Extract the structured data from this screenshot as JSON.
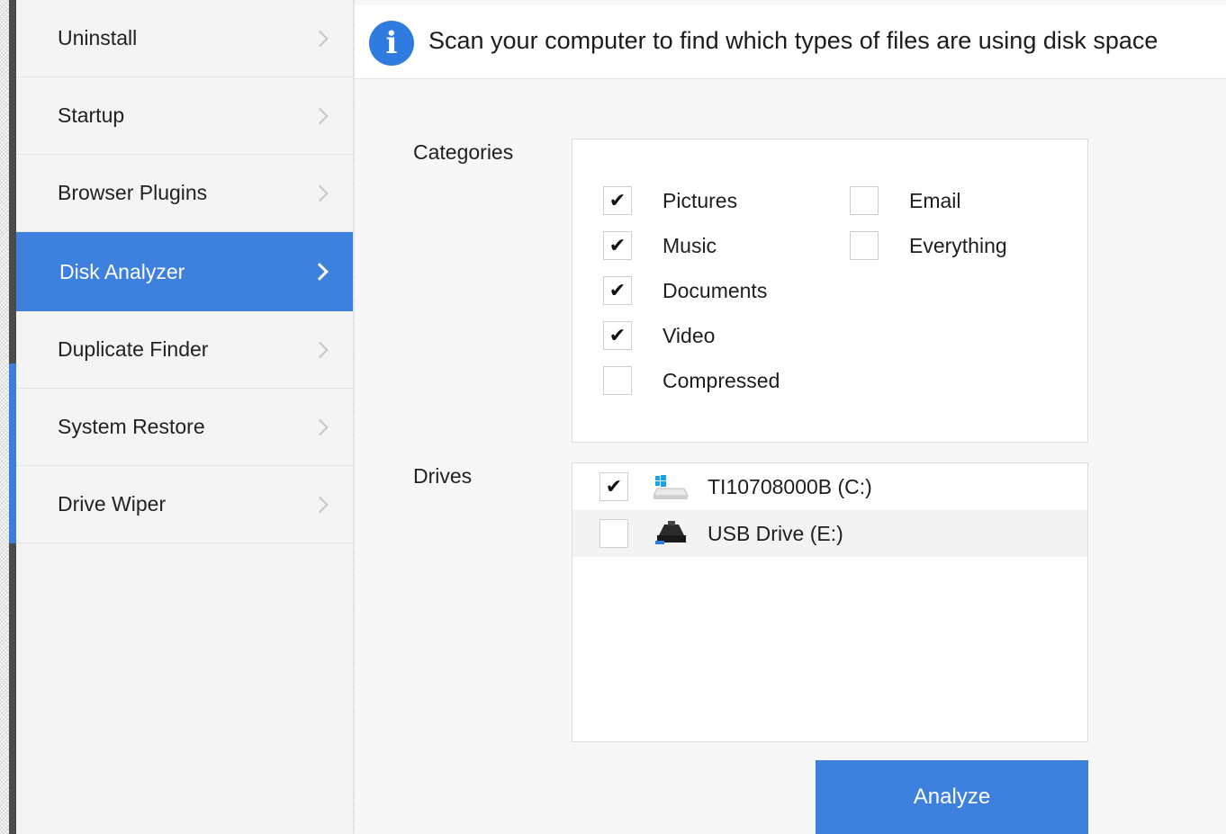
{
  "sidebar": {
    "items": [
      {
        "label": "Uninstall",
        "active": false
      },
      {
        "label": "Startup",
        "active": false
      },
      {
        "label": "Browser Plugins",
        "active": false
      },
      {
        "label": "Disk Analyzer",
        "active": true
      },
      {
        "label": "Duplicate Finder",
        "active": false
      },
      {
        "label": "System Restore",
        "active": false
      },
      {
        "label": "Drive Wiper",
        "active": false
      }
    ]
  },
  "info": {
    "icon": "info-icon",
    "glyph": "i",
    "text": "Scan your computer to find which types of files are using disk space"
  },
  "categories": {
    "label": "Categories",
    "items": [
      {
        "label": "Pictures",
        "checked": true
      },
      {
        "label": "Music",
        "checked": true
      },
      {
        "label": "Documents",
        "checked": true
      },
      {
        "label": "Video",
        "checked": true
      },
      {
        "label": "Compressed",
        "checked": false
      },
      {
        "label": "Email",
        "checked": false
      },
      {
        "label": "Everything",
        "checked": false
      }
    ]
  },
  "drives": {
    "label": "Drives",
    "items": [
      {
        "label": "TI10708000B (C:)",
        "checked": true,
        "icon": "windows-drive-icon"
      },
      {
        "label": "USB Drive (E:)",
        "checked": false,
        "icon": "usb-drive-icon"
      }
    ]
  },
  "actions": {
    "analyze_label": "Analyze"
  },
  "colors": {
    "accent": "#3d80dd",
    "info_icon": "#2f7be0",
    "sidebar_bg": "#f4f4f4"
  }
}
